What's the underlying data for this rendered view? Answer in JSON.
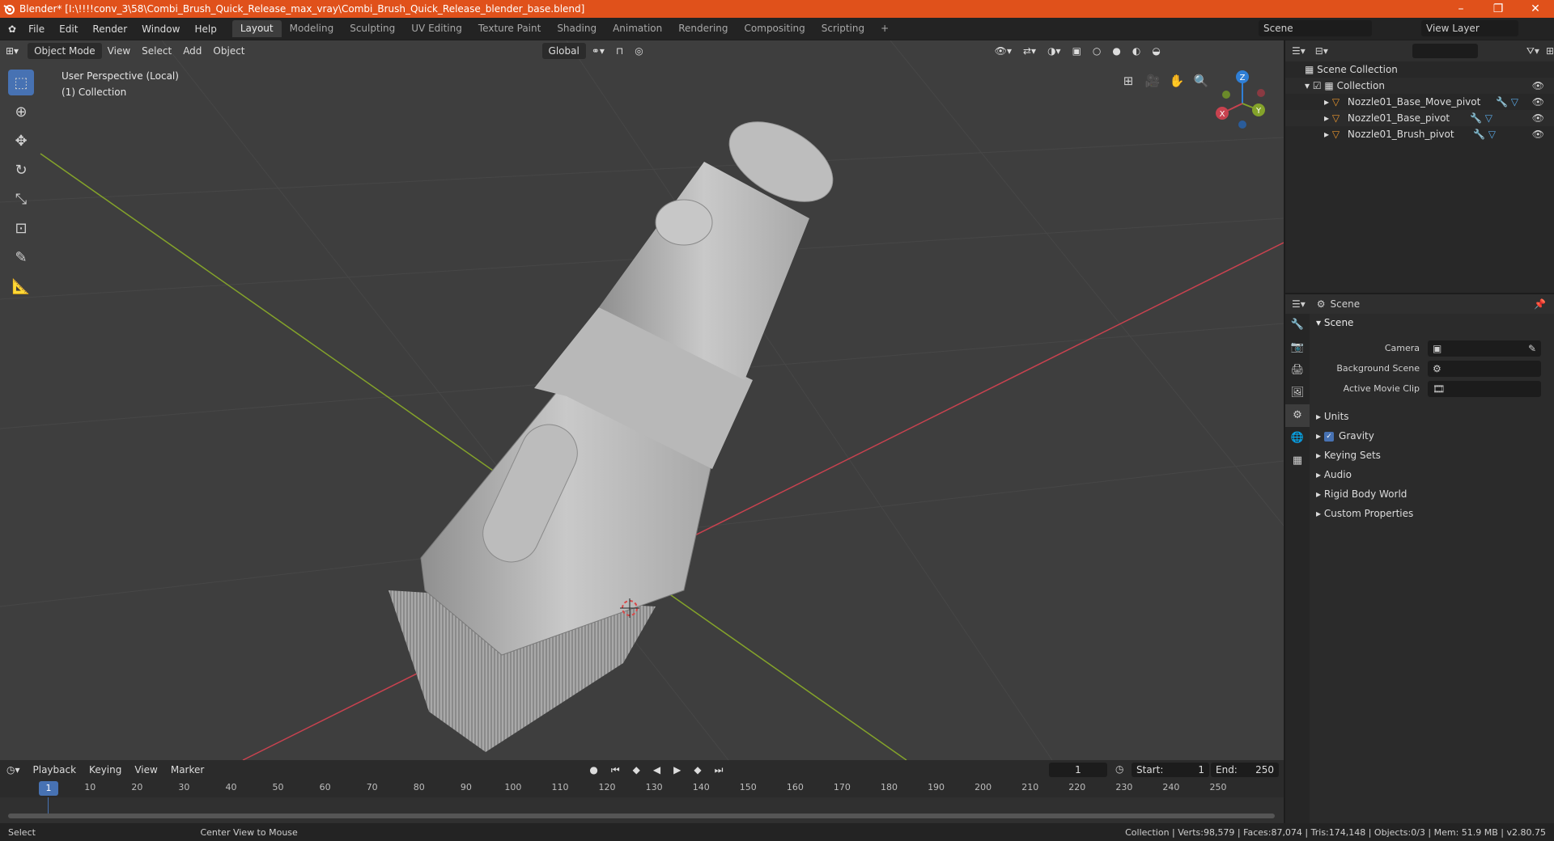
{
  "window": {
    "title": "Blender* [I:\\!!!!conv_3\\58\\Combi_Brush_Quick_Release_max_vray\\Combi_Brush_Quick_Release_blender_base.blend]",
    "minimize": "–",
    "maximize": "❐",
    "close": "✕"
  },
  "menu": {
    "items": [
      "File",
      "Edit",
      "Render",
      "Window",
      "Help"
    ]
  },
  "workspaces": {
    "tabs": [
      "Layout",
      "Modeling",
      "Sculpting",
      "UV Editing",
      "Texture Paint",
      "Shading",
      "Animation",
      "Rendering",
      "Compositing",
      "Scripting"
    ],
    "add": "+",
    "scene": "Scene",
    "view_layer": "View Layer"
  },
  "viewport": {
    "mode": "Object Mode",
    "menus": [
      "View",
      "Select",
      "Add",
      "Object"
    ],
    "transform_orientation": "Global",
    "info_line1": "User Perspective (Local)",
    "info_line2": "(1) Collection",
    "gizmo": {
      "x": "X",
      "y": "Y",
      "z": "Z"
    }
  },
  "timeline": {
    "menus": [
      "Playback",
      "Keying",
      "View",
      "Marker"
    ],
    "current_frame": "1",
    "start_label": "Start:",
    "start": "1",
    "end_label": "End:",
    "end": "250",
    "ticks": [
      "10",
      "20",
      "30",
      "40",
      "50",
      "60",
      "70",
      "80",
      "90",
      "100",
      "110",
      "120",
      "130",
      "140",
      "150",
      "160",
      "170",
      "180",
      "190",
      "200",
      "210",
      "220",
      "230",
      "240",
      "250"
    ],
    "playhead": "1"
  },
  "statusbar": {
    "select": "Select",
    "center_view": "Center View to Mouse",
    "stats": "Collection | Verts:98,579 | Faces:87,074 | Tris:174,148 | Objects:0/3 | Mem: 51.9 MB | v2.80.75"
  },
  "outliner": {
    "scene_collection": "Scene Collection",
    "collection": "Collection",
    "objects": [
      "Nozzle01_Base_Move_pivot",
      "Nozzle01_Base_pivot",
      "Nozzle01_Brush_pivot"
    ]
  },
  "properties": {
    "context": "Scene",
    "panel": "Scene",
    "camera_label": "Camera",
    "background_scene_label": "Background Scene",
    "active_clip_label": "Active Movie Clip",
    "subpanels": [
      "Units",
      "Gravity",
      "Keying Sets",
      "Audio",
      "Rigid Body World",
      "Custom Properties"
    ]
  },
  "colors": {
    "titlebar": "#e0511b",
    "accent": "#4772b3",
    "x_axis": "#c8424f",
    "y_axis": "#84a32a",
    "z_axis": "#2f7fd6"
  }
}
